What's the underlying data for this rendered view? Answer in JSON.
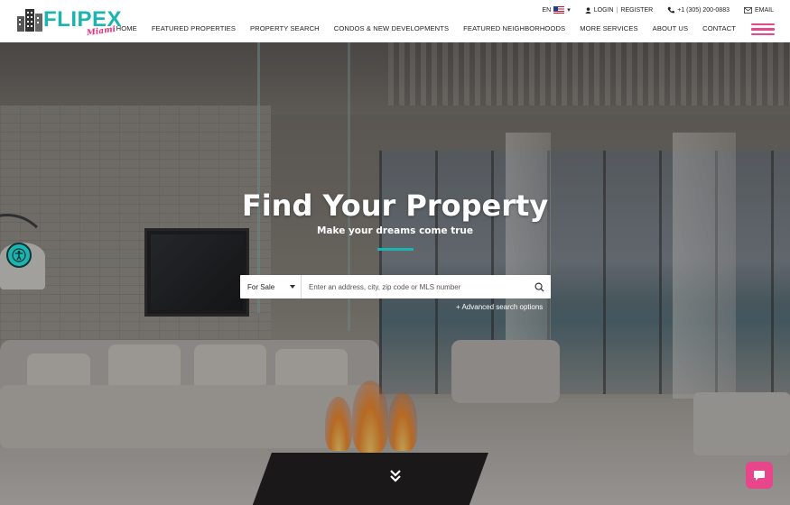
{
  "brand": {
    "name": "FLIPEX",
    "tagline": "Miami",
    "accent": "#1bb4b0",
    "pink": "#e8468a"
  },
  "topbar": {
    "language": "EN",
    "language_icon": "us-flag-icon",
    "login": "LOGIN",
    "register": "REGISTER",
    "phone": "+1 (305) 200-0883",
    "email": "EMAIL"
  },
  "nav": {
    "items": [
      "HOME",
      "FEATURED PROPERTIES",
      "PROPERTY SEARCH",
      "CONDOS & NEW DEVELOPMENTS",
      "FEATURED NEIGHBORHOODS",
      "MORE SERVICES",
      "ABOUT US",
      "CONTACT"
    ]
  },
  "hero": {
    "title": "Find Your Property",
    "subtitle": "Make your dreams come true"
  },
  "search": {
    "type_selected": "For Sale",
    "placeholder": "Enter an address, city, zip code or MLS number",
    "advanced": "+ Advanced search options"
  },
  "icons": {
    "accessibility": "accessibility-icon",
    "chat": "chat-icon",
    "scroll": "double-chevron-down-icon",
    "search": "search-icon"
  }
}
